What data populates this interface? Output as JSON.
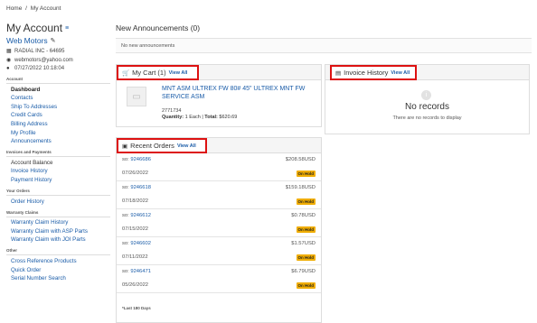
{
  "breadcrumb": {
    "home": "Home",
    "sep": "/",
    "current": "My Account"
  },
  "sidebar": {
    "title": "My Account",
    "company": "Web Motors",
    "info": {
      "account": "RADIAL INC - 64695",
      "email": "webmotors@yahoo.com",
      "datetime": "07/27/2022 10:18:04"
    },
    "sections": {
      "account": "Account",
      "invoices": "Invoices and Payments",
      "orders": "Your Orders",
      "warranty": "Warranty Claims",
      "other": "Other"
    },
    "account_items": [
      "Dashboard",
      "Contacts",
      "Ship To Addresses",
      "Credit Cards",
      "Billing Address",
      "My Profile",
      "Announcements"
    ],
    "invoice_items": [
      "Account Balance",
      "Invoice History",
      "Payment History"
    ],
    "order_items": [
      "Order History"
    ],
    "warranty_items": [
      "Warranty Claim History",
      "Warranty Claim with ASP Parts",
      "Warranty Claim with JOI Parts"
    ],
    "other_items": [
      "Cross Reference Products",
      "Quick Order",
      "Serial Number Search"
    ]
  },
  "announcements": {
    "title": "New Announcements (0)",
    "empty": "No new announcements"
  },
  "cart": {
    "title": "My Cart (1)",
    "view_all": "View All",
    "product_name": "MNT ASM ULTREX FW 80# 45\" ULTREX MNT FW SERVICE ASM",
    "sku": "2771734",
    "qty_label": "Quantity:",
    "qty_value": "1 Each",
    "total_label": "Total:",
    "total_value": "$620.69"
  },
  "invoice": {
    "title": "Invoice History",
    "view_all": "View All",
    "empty_title": "No records",
    "empty_sub": "There are no records to display"
  },
  "orders": {
    "title": "Recent Orders",
    "view_all": "View All",
    "so_prefix": "so:",
    "rows": [
      {
        "number": "9246686",
        "amount": "$208.58USD",
        "date": "07/26/2022",
        "status": "On Hold"
      },
      {
        "number": "9246618",
        "amount": "$159.18USD",
        "date": "07/18/2022",
        "status": "On Hold"
      },
      {
        "number": "9246612",
        "amount": "$0.78USD",
        "date": "07/15/2022",
        "status": "On Hold"
      },
      {
        "number": "9246602",
        "amount": "$1.57USD",
        "date": "07/11/2022",
        "status": "On Hold"
      },
      {
        "number": "9246471",
        "amount": "$6.79USD",
        "date": "05/26/2022",
        "status": "On Hold"
      }
    ],
    "footnote": "*Last 180 Days"
  },
  "colors": {
    "link": "#1a5ca8",
    "highlight": "#dd1111",
    "badge": "#f0ad00"
  }
}
